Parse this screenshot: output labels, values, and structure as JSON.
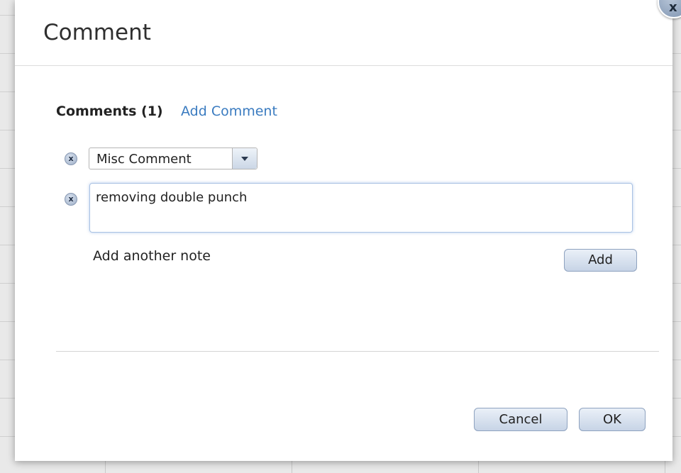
{
  "dialog": {
    "title": "Comment",
    "close_glyph": "x"
  },
  "comments": {
    "heading": "Comments (1)",
    "add_link": "Add Comment",
    "remove_glyph": "x",
    "category_select": {
      "value": "Misc Comment"
    },
    "note_text": "removing double punch",
    "add_another_label": "Add another note",
    "add_button": "Add"
  },
  "footer": {
    "cancel_button": "Cancel",
    "ok_button": "OK"
  },
  "colors": {
    "link": "#3a7bc0",
    "button_top": "#eaf0f8",
    "button_bottom": "#c7d4e6",
    "focus_border": "#a9c2e3"
  },
  "icons": {
    "close": "close-icon",
    "remove": "remove-icon",
    "dropdown": "chevron-down-icon"
  }
}
